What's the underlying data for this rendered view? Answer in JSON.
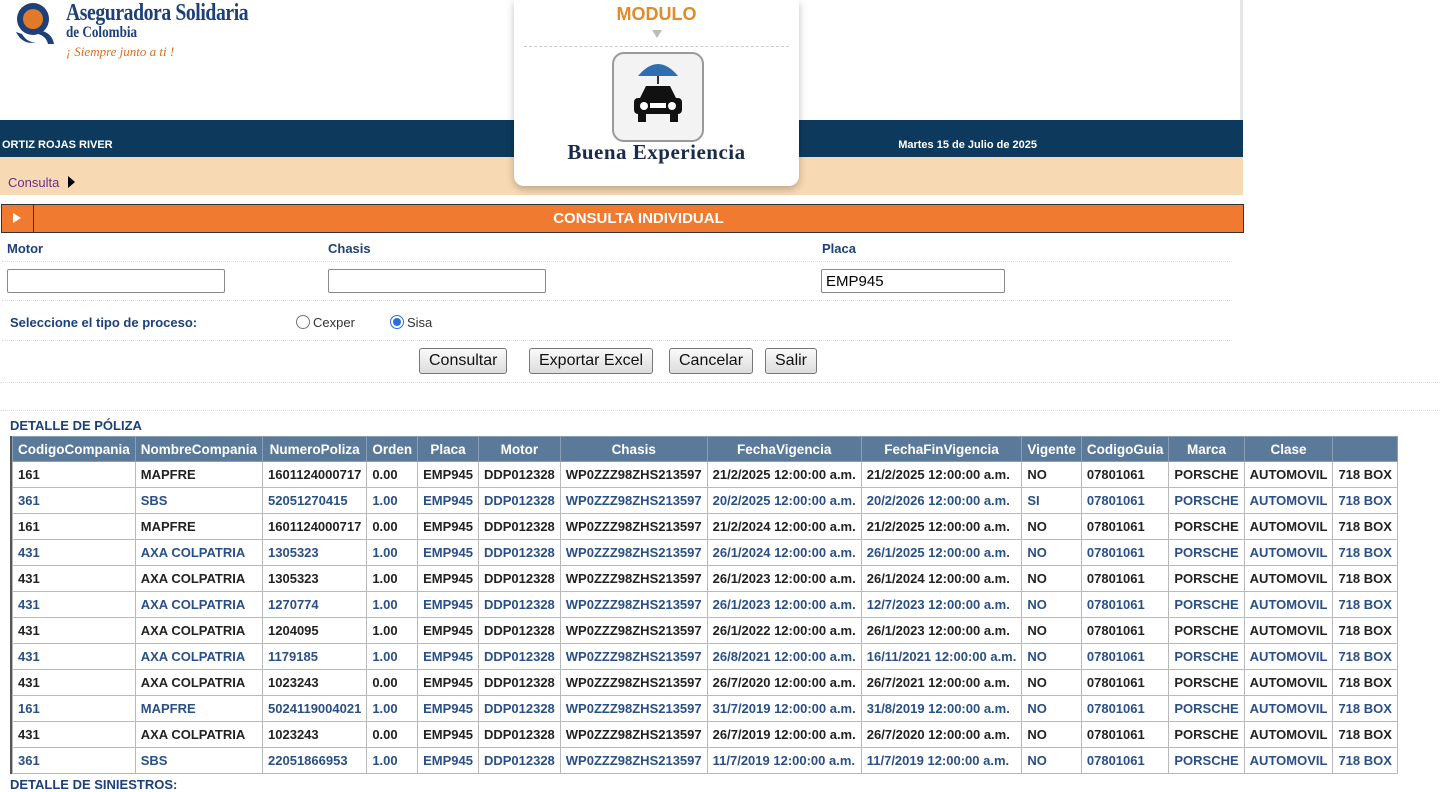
{
  "header": {
    "logo_name": "Aseguradora Solidaria",
    "logo_sub": "de Colombia",
    "logo_slogan": "¡ Siempre junto a ti !",
    "user_name": "ORTIZ ROJAS RIVER",
    "date": "Martes 15 de Julio de 2025",
    "breadcrumb": "Consulta"
  },
  "module": {
    "title": "MODULO",
    "caption": "Buena Experiencia",
    "icon": "car-umbrella-icon"
  },
  "consulta": {
    "title": "CONSULTA INDIVIDUAL",
    "toggle_icon": "expand-arrow-icon"
  },
  "form": {
    "motor_label": "Motor",
    "motor_value": "",
    "chasis_label": "Chasis",
    "chasis_value": "",
    "placa_label": "Placa",
    "placa_value": "EMP945",
    "tipo_label": "Seleccione el tipo de proceso:",
    "radio_cexper": "Cexper",
    "radio_sisa": "Sisa",
    "selected_process": "Sisa"
  },
  "buttons": {
    "consultar": "Consultar",
    "exportar": "Exportar Excel",
    "cancelar": "Cancelar",
    "salir": "Salir"
  },
  "detalle": {
    "title": "DETALLE DE PÓLIZA",
    "columns": [
      "CodigoCompania",
      "NombreCompania",
      "NumeroPoliza",
      "Orden",
      "Placa",
      "Motor",
      "Chasis",
      "FechaVigencia",
      "FechaFinVigencia",
      "Vigente",
      "CodigoGuia",
      "Marca",
      "Clase",
      ""
    ],
    "rows": [
      [
        "161",
        "MAPFRE",
        "1601124000717",
        "0.00",
        "EMP945",
        "DDP012328",
        "WP0ZZZ98ZHS213597",
        "21/2/2025 12:00:00 a.m.",
        "21/2/2025 12:00:00 a.m.",
        "NO",
        "07801061",
        "PORSCHE",
        "AUTOMOVIL",
        "718 BOX"
      ],
      [
        "361",
        "SBS",
        "52051270415",
        "1.00",
        "EMP945",
        "DDP012328",
        "WP0ZZZ98ZHS213597",
        "20/2/2025 12:00:00 a.m.",
        "20/2/2026 12:00:00 a.m.",
        "SI",
        "07801061",
        "PORSCHE",
        "AUTOMOVIL",
        "718 BOX"
      ],
      [
        "161",
        "MAPFRE",
        "1601124000717",
        "0.00",
        "EMP945",
        "DDP012328",
        "WP0ZZZ98ZHS213597",
        "21/2/2024 12:00:00 a.m.",
        "21/2/2025 12:00:00 a.m.",
        "NO",
        "07801061",
        "PORSCHE",
        "AUTOMOVIL",
        "718 BOX"
      ],
      [
        "431",
        "AXA COLPATRIA",
        "1305323",
        "1.00",
        "EMP945",
        "DDP012328",
        "WP0ZZZ98ZHS213597",
        "26/1/2024 12:00:00 a.m.",
        "26/1/2025 12:00:00 a.m.",
        "NO",
        "07801061",
        "PORSCHE",
        "AUTOMOVIL",
        "718 BOX"
      ],
      [
        "431",
        "AXA COLPATRIA",
        "1305323",
        "1.00",
        "EMP945",
        "DDP012328",
        "WP0ZZZ98ZHS213597",
        "26/1/2023 12:00:00 a.m.",
        "26/1/2024 12:00:00 a.m.",
        "NO",
        "07801061",
        "PORSCHE",
        "AUTOMOVIL",
        "718 BOX"
      ],
      [
        "431",
        "AXA COLPATRIA",
        "1270774",
        "1.00",
        "EMP945",
        "DDP012328",
        "WP0ZZZ98ZHS213597",
        "26/1/2023 12:00:00 a.m.",
        "12/7/2023 12:00:00 a.m.",
        "NO",
        "07801061",
        "PORSCHE",
        "AUTOMOVIL",
        "718 BOX"
      ],
      [
        "431",
        "AXA COLPATRIA",
        "1204095",
        "1.00",
        "EMP945",
        "DDP012328",
        "WP0ZZZ98ZHS213597",
        "26/1/2022 12:00:00 a.m.",
        "26/1/2023 12:00:00 a.m.",
        "NO",
        "07801061",
        "PORSCHE",
        "AUTOMOVIL",
        "718 BOX"
      ],
      [
        "431",
        "AXA COLPATRIA",
        "1179185",
        "1.00",
        "EMP945",
        "DDP012328",
        "WP0ZZZ98ZHS213597",
        "26/8/2021 12:00:00 a.m.",
        "16/11/2021 12:00:00 a.m.",
        "NO",
        "07801061",
        "PORSCHE",
        "AUTOMOVIL",
        "718 BOX"
      ],
      [
        "431",
        "AXA COLPATRIA",
        "1023243",
        "0.00",
        "EMP945",
        "DDP012328",
        "WP0ZZZ98ZHS213597",
        "26/7/2020 12:00:00 a.m.",
        "26/7/2021 12:00:00 a.m.",
        "NO",
        "07801061",
        "PORSCHE",
        "AUTOMOVIL",
        "718 BOX"
      ],
      [
        "161",
        "MAPFRE",
        "5024119004021",
        "1.00",
        "EMP945",
        "DDP012328",
        "WP0ZZZ98ZHS213597",
        "31/7/2019 12:00:00 a.m.",
        "31/8/2019 12:00:00 a.m.",
        "NO",
        "07801061",
        "PORSCHE",
        "AUTOMOVIL",
        "718 BOX"
      ],
      [
        "431",
        "AXA COLPATRIA",
        "1023243",
        "0.00",
        "EMP945",
        "DDP012328",
        "WP0ZZZ98ZHS213597",
        "26/7/2019 12:00:00 a.m.",
        "26/7/2020 12:00:00 a.m.",
        "NO",
        "07801061",
        "PORSCHE",
        "AUTOMOVIL",
        "718 BOX"
      ],
      [
        "361",
        "SBS",
        "22051866953",
        "1.00",
        "EMP945",
        "DDP012328",
        "WP0ZZZ98ZHS213597",
        "11/7/2019 12:00:00 a.m.",
        "11/7/2019 12:00:00 a.m.",
        "NO",
        "07801061",
        "PORSCHE",
        "AUTOMOVIL",
        "718 BOX"
      ]
    ]
  },
  "siniestros": {
    "title": "DETALLE DE SINIESTROS:"
  },
  "colors": {
    "navy": "#0d3a5c",
    "orange": "#f07a30",
    "peach": "#f7d9b3",
    "header_blue": "#5b7a9a",
    "link_blue": "#2a4f86"
  }
}
